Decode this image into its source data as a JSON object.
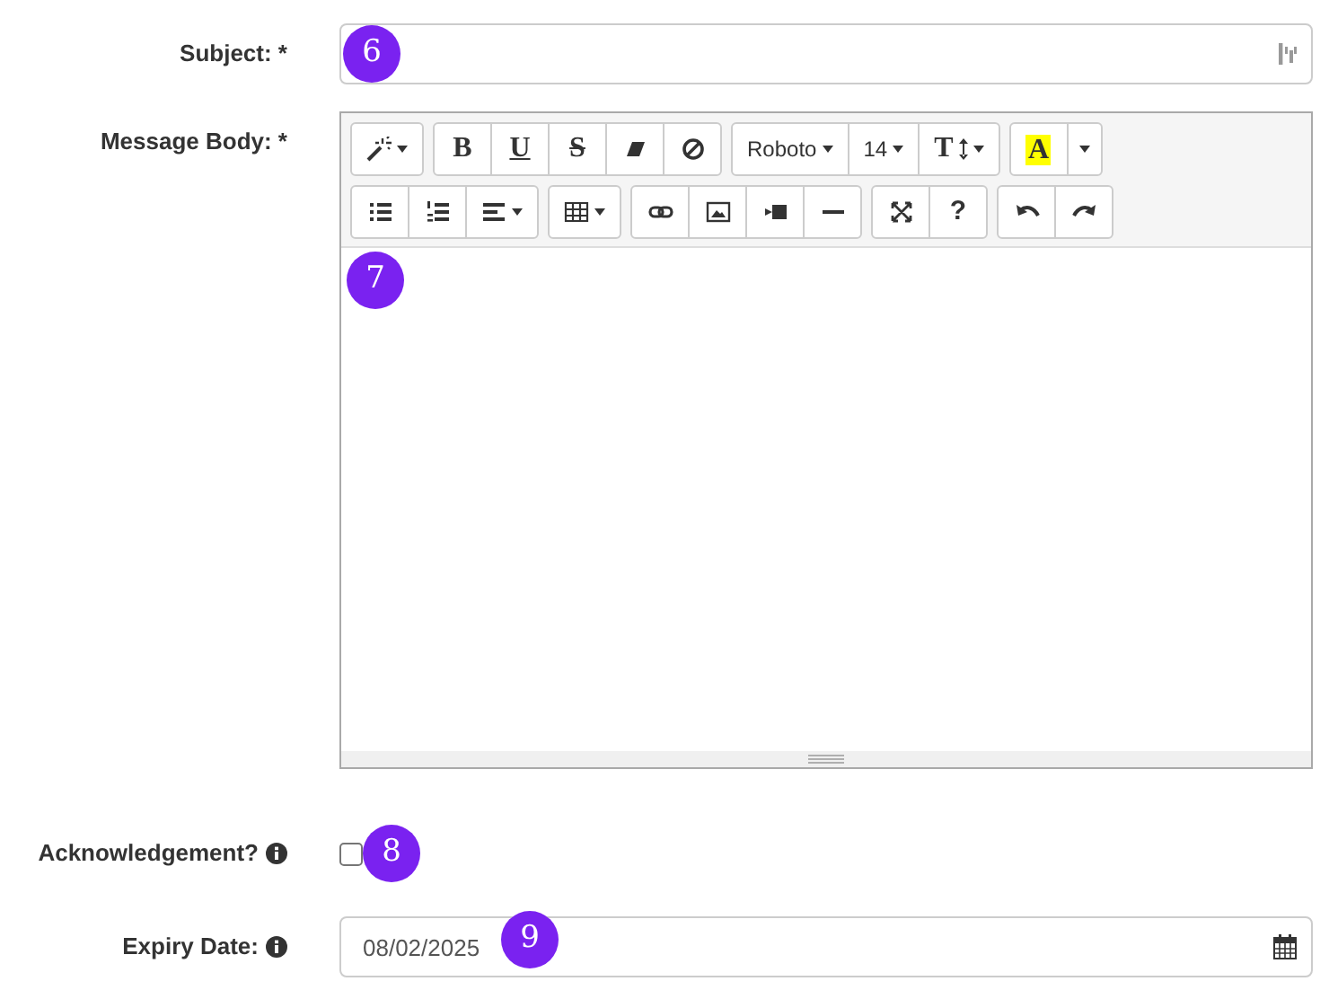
{
  "form": {
    "fields": [
      {
        "kind": "text",
        "label": "Subject: *",
        "callout": "6"
      },
      {
        "kind": "editor",
        "label": "Message Body: *",
        "callout": "7",
        "toolbar": [
          [
            [
              {
                "kind": "magic",
                "caret": true
              }
            ],
            [
              {
                "kind": "bold",
                "text": "B"
              },
              {
                "kind": "underline",
                "text": "U"
              },
              {
                "kind": "strike",
                "text": "S"
              },
              {
                "kind": "eraser"
              },
              {
                "kind": "clear"
              }
            ],
            [
              {
                "kind": "font",
                "text": "Roboto",
                "caret": true
              },
              {
                "kind": "font",
                "text": "14",
                "caret": true
              },
              {
                "kind": "lineheight",
                "text": "T",
                "caret": true
              }
            ],
            [
              {
                "kind": "color",
                "text": "A"
              },
              {
                "kind": "blank",
                "caret": true
              }
            ]
          ],
          [
            [
              {
                "kind": "ul"
              },
              {
                "kind": "ol"
              },
              {
                "kind": "align",
                "caret": true
              }
            ],
            [
              {
                "kind": "table",
                "caret": true
              }
            ],
            [
              {
                "kind": "link"
              },
              {
                "kind": "picture"
              },
              {
                "kind": "video"
              },
              {
                "kind": "hr"
              }
            ],
            [
              {
                "kind": "fullscreen"
              },
              {
                "kind": "help",
                "text": "?"
              }
            ],
            [
              {
                "kind": "undo"
              },
              {
                "kind": "redo"
              }
            ]
          ]
        ]
      },
      {
        "kind": "checkbox",
        "label": "Acknowledgement?",
        "info": true,
        "checked": false,
        "callout": "8"
      },
      {
        "kind": "date",
        "label": "Expiry Date:",
        "info": true,
        "value": "08/02/2025",
        "callout": "9"
      }
    ]
  }
}
